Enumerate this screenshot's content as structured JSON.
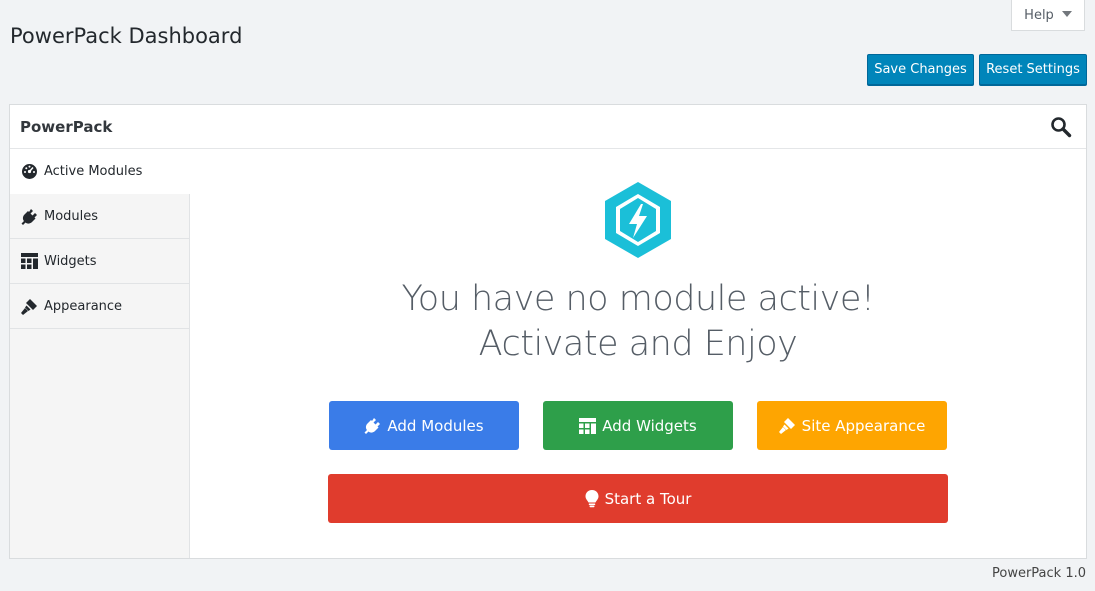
{
  "page": {
    "title": "PowerPack Dashboard"
  },
  "help": {
    "label": "Help"
  },
  "toolbar": {
    "save_label": "Save Changes",
    "reset_label": "Reset Settings"
  },
  "panel": {
    "title": "PowerPack"
  },
  "sidebar": {
    "items": [
      {
        "label": "Active Modules",
        "icon": "dashboard-icon",
        "active": true
      },
      {
        "label": "Modules",
        "icon": "plugin-icon",
        "active": false
      },
      {
        "label": "Widgets",
        "icon": "widgets-grid-icon",
        "active": false
      },
      {
        "label": "Appearance",
        "icon": "brush-icon",
        "active": false
      }
    ]
  },
  "main": {
    "headline_line1": "You have no module active!",
    "headline_line2": "Activate and Enjoy",
    "buttons": {
      "add_modules": "Add Modules",
      "add_widgets": "Add Widgets",
      "site_appearance": "Site Appearance",
      "start_tour": "Start a Tour"
    }
  },
  "footer": {
    "version": "PowerPack 1.0"
  },
  "colors": {
    "primary": "#0085ba",
    "add_modules": "#3a7ce8",
    "add_widgets": "#2e9f4a",
    "site_appearance": "#fea501",
    "start_tour": "#e03c2d",
    "logo": "#1bbfd8"
  }
}
